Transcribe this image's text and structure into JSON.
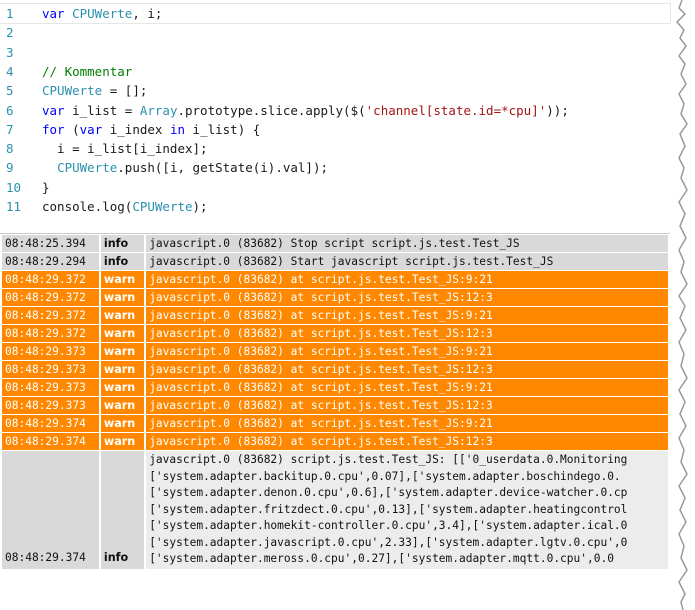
{
  "editor": {
    "lines": [
      {
        "num": "1",
        "tokens": [
          {
            "c": "kw",
            "t": "var "
          },
          {
            "c": "id",
            "t": "CPUWerte"
          },
          {
            "c": "",
            "t": ", i;"
          }
        ]
      },
      {
        "num": "2",
        "tokens": []
      },
      {
        "num": "3",
        "tokens": []
      },
      {
        "num": "4",
        "tokens": [
          {
            "c": "cm",
            "t": "// Kommentar"
          }
        ]
      },
      {
        "num": "5",
        "tokens": [
          {
            "c": "id",
            "t": "CPUWerte"
          },
          {
            "c": "",
            "t": " = [];"
          }
        ]
      },
      {
        "num": "6",
        "tokens": [
          {
            "c": "kw",
            "t": "var "
          },
          {
            "c": "",
            "t": "i_list = "
          },
          {
            "c": "id",
            "t": "Array"
          },
          {
            "c": "",
            "t": ".prototype.slice.apply($("
          },
          {
            "c": "st",
            "t": "'channel[state.id=*cpu]'"
          },
          {
            "c": "",
            "t": "));"
          }
        ]
      },
      {
        "num": "7",
        "tokens": [
          {
            "c": "kw",
            "t": "for "
          },
          {
            "c": "",
            "t": "("
          },
          {
            "c": "kw",
            "t": "var "
          },
          {
            "c": "",
            "t": "i_index "
          },
          {
            "c": "kw",
            "t": "in "
          },
          {
            "c": "",
            "t": "i_list) {"
          }
        ]
      },
      {
        "num": "8",
        "tokens": [
          {
            "c": "",
            "t": "  i = i_list[i_index];"
          }
        ]
      },
      {
        "num": "9",
        "tokens": [
          {
            "c": "",
            "t": "  "
          },
          {
            "c": "id",
            "t": "CPUWerte"
          },
          {
            "c": "",
            "t": ".push([i, getState(i).val]);"
          }
        ]
      },
      {
        "num": "10",
        "tokens": [
          {
            "c": "",
            "t": "}"
          }
        ]
      },
      {
        "num": "11",
        "tokens": [
          {
            "c": "",
            "t": "console.log("
          },
          {
            "c": "id",
            "t": "CPUWerte"
          },
          {
            "c": "",
            "t": ");"
          }
        ]
      }
    ]
  },
  "log": {
    "rows": [
      {
        "time": "08:48:25.394",
        "level": "info",
        "message": "javascript.0 (83682) Stop script script.js.test.Test_JS"
      },
      {
        "time": "08:48:29.294",
        "level": "info",
        "message": "javascript.0 (83682) Start javascript script.js.test.Test_JS"
      },
      {
        "time": "08:48:29.372",
        "level": "warn",
        "message": "javascript.0 (83682) at script.js.test.Test_JS:9:21"
      },
      {
        "time": "08:48:29.372",
        "level": "warn",
        "message": "javascript.0 (83682) at script.js.test.Test_JS:12:3"
      },
      {
        "time": "08:48:29.372",
        "level": "warn",
        "message": "javascript.0 (83682) at script.js.test.Test_JS:9:21"
      },
      {
        "time": "08:48:29.372",
        "level": "warn",
        "message": "javascript.0 (83682) at script.js.test.Test_JS:12:3"
      },
      {
        "time": "08:48:29.373",
        "level": "warn",
        "message": "javascript.0 (83682) at script.js.test.Test_JS:9:21"
      },
      {
        "time": "08:48:29.373",
        "level": "warn",
        "message": "javascript.0 (83682) at script.js.test.Test_JS:12:3"
      },
      {
        "time": "08:48:29.373",
        "level": "warn",
        "message": "javascript.0 (83682) at script.js.test.Test_JS:9:21"
      },
      {
        "time": "08:48:29.373",
        "level": "warn",
        "message": "javascript.0 (83682) at script.js.test.Test_JS:12:3"
      },
      {
        "time": "08:48:29.374",
        "level": "warn",
        "message": "javascript.0 (83682) at script.js.test.Test_JS:9:21"
      },
      {
        "time": "08:48:29.374",
        "level": "warn",
        "message": "javascript.0 (83682) at script.js.test.Test_JS:12:3"
      }
    ],
    "multi": {
      "time": "08:48:29.374",
      "level": "info",
      "message_lines": [
        "javascript.0 (83682) script.js.test.Test_JS: [['0_userdata.0.Monitoring",
        "['system.adapter.backitup.0.cpu',0.07],['system.adapter.boschindego.0.",
        "['system.adapter.denon.0.cpu',0.6],['system.adapter.device-watcher.0.cp",
        "['system.adapter.fritzdect.0.cpu',0.13],['system.adapter.heatingcontrol",
        "['system.adapter.homekit-controller.0.cpu',3.4],['system.adapter.ical.0",
        "['system.adapter.javascript.0.cpu',2.33],['system.adapter.lgtv.0.cpu',0",
        "['system.adapter.meross.0.cpu',0.27],['system.adapter.mqtt.0.cpu',0.0"
      ]
    }
  }
}
